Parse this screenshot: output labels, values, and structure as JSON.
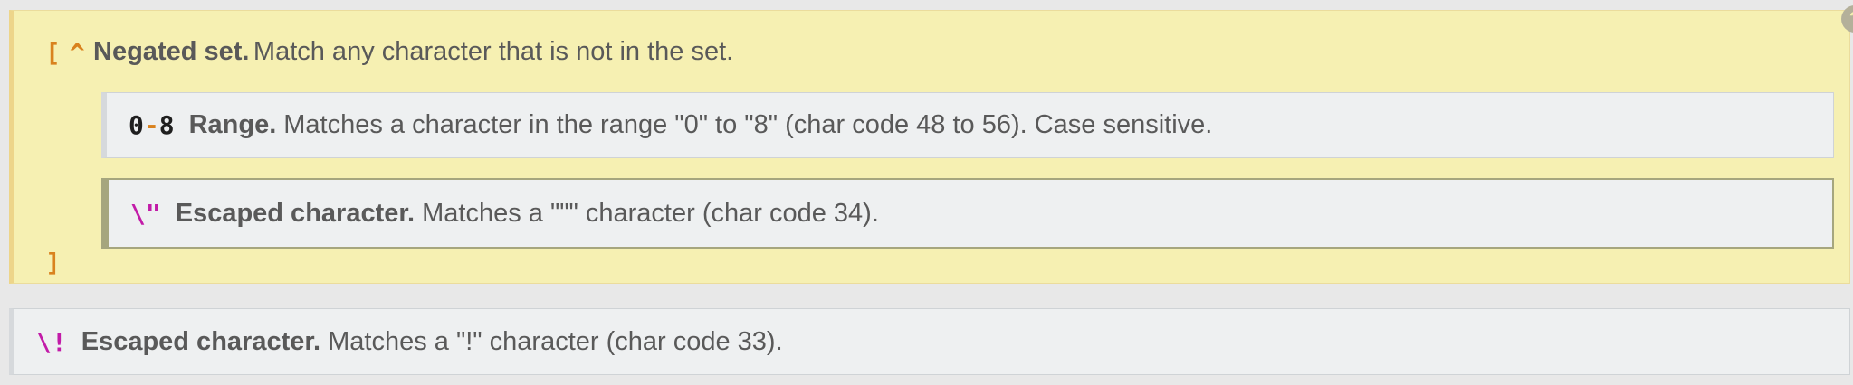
{
  "negated_set": {
    "open_token_bracket": "[",
    "open_token_caret": "^",
    "title": "Negated set.",
    "description": "Match any character that is not in the set.",
    "close_token": "]",
    "items": [
      {
        "token_start": "0",
        "token_dash": "-",
        "token_end": "8",
        "title": "Range.",
        "description": "Matches a character in the range \"0\" to \"8\" (char code 48 to 56). Case sensitive."
      },
      {
        "token": "\\\"",
        "title": "Escaped character.",
        "description": "Matches a \"\"\" character (char code 34)."
      }
    ]
  },
  "escaped_item": {
    "token": "\\!",
    "title": "Escaped character.",
    "description": "Matches a \"!\" character (char code 33)."
  },
  "help": {
    "icon": "question-icon",
    "glyph": "?"
  },
  "colors": {
    "set_background": "#f6f0b2",
    "item_background": "#eef0f1",
    "token_orange": "#d9821e",
    "token_magenta": "#c21ba8",
    "selected_border": "#a6a67e"
  }
}
